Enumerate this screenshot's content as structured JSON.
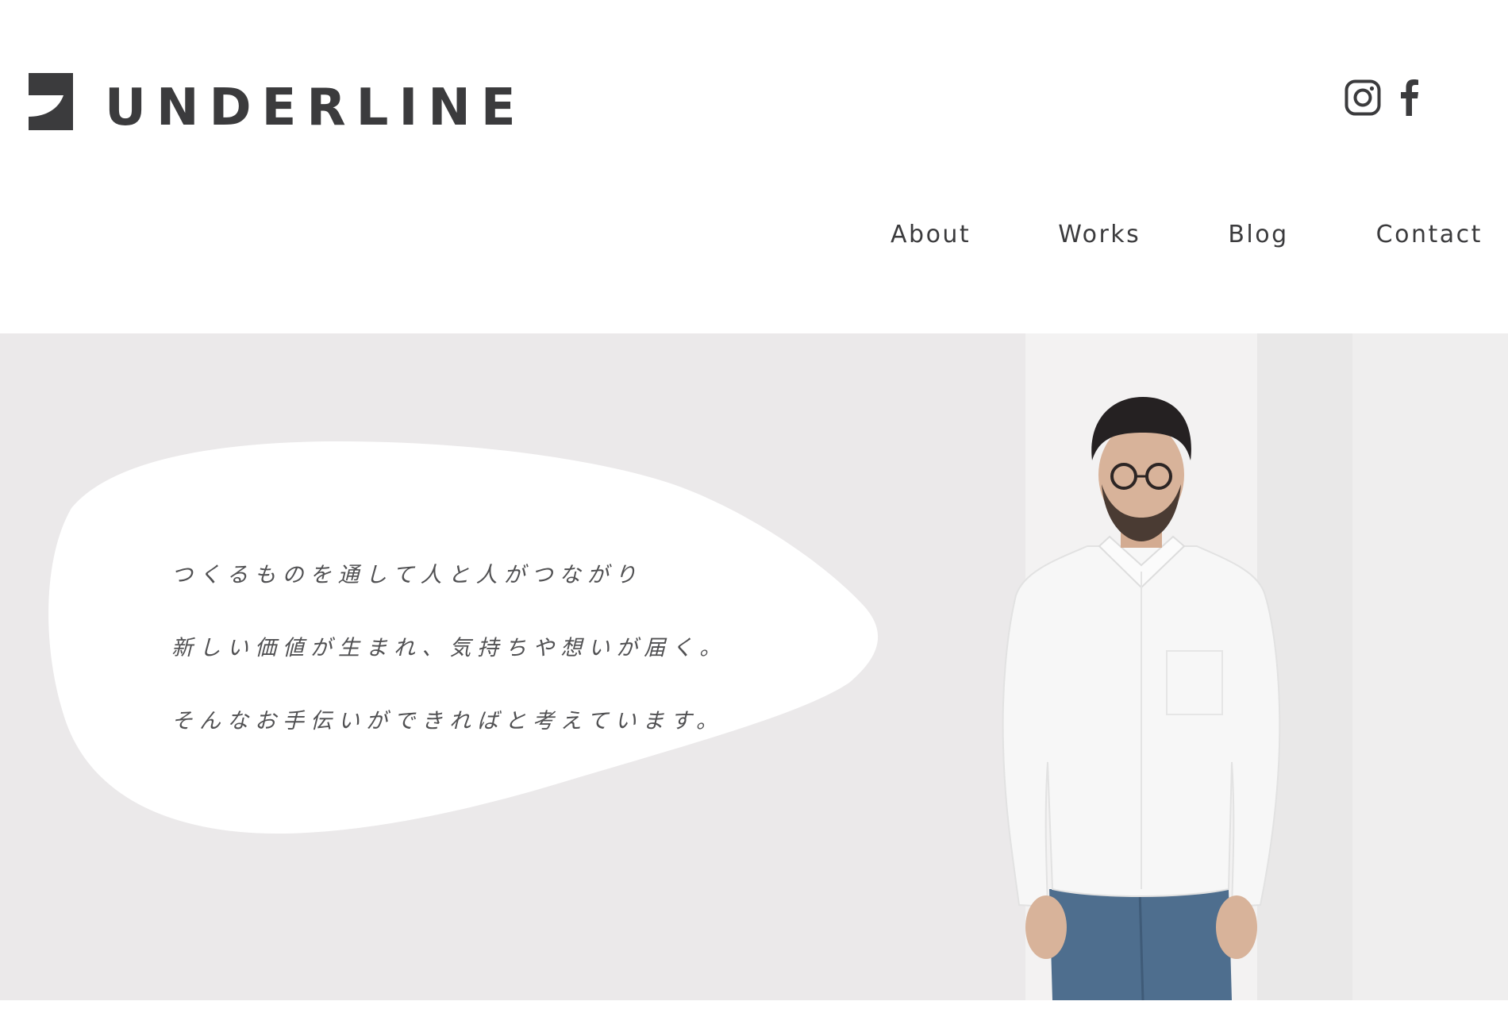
{
  "brand": {
    "name": "UNDERLINE",
    "logo_icon": "underline-logo-mark"
  },
  "social": {
    "instagram_icon": "instagram-icon",
    "facebook_icon": "facebook-icon"
  },
  "nav": {
    "items": [
      {
        "label": "About"
      },
      {
        "label": "Works"
      },
      {
        "label": "Blog"
      },
      {
        "label": "Contact"
      }
    ]
  },
  "hero": {
    "lines": [
      "つくるものを通して人と人がつながり",
      "新しい価値が生まれ、気持ちや想いが届く。",
      "そんなお手伝いができればと考えています。"
    ]
  },
  "colors": {
    "text": "#3b3b3d",
    "hero_bg": "#ebe9ea",
    "bubble": "#ffffff"
  }
}
